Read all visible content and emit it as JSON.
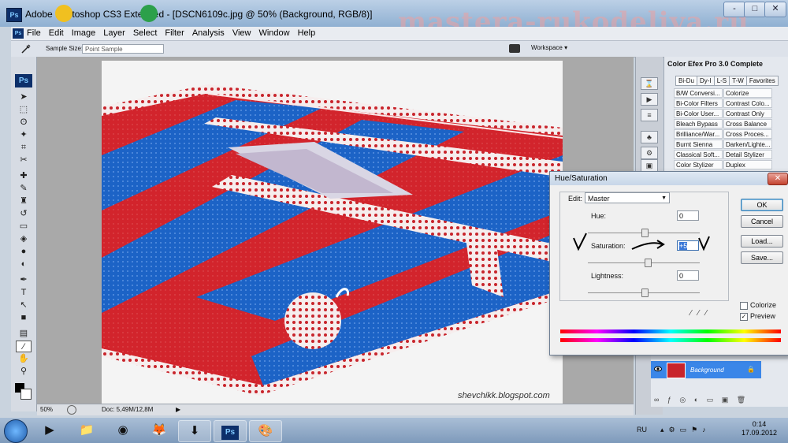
{
  "window": {
    "title": "Adobe Photoshop CS3 Extended - [DSCN6109c.jpg @ 50% (Background, RGB/8)]",
    "logo": "Ps",
    "minimize": "-",
    "restore": "□",
    "close": "✕"
  },
  "watermark": "mastera-rukodeliya.ru",
  "menu": [
    "File",
    "Edit",
    "Image",
    "Layer",
    "Select",
    "Filter",
    "Analysis",
    "View",
    "Window",
    "Help"
  ],
  "options": {
    "sample_size_label": "Sample Size:",
    "sample_size_value": "Point Sample",
    "workspace": "Workspace ▾"
  },
  "toolbox": {
    "logo": "Ps"
  },
  "photo": {
    "credit": "shevchikk.blogspot.com"
  },
  "status": {
    "zoom": "50%",
    "doc": "Doc: 5,49M/12,8M"
  },
  "efex": {
    "title": "Color Efex Pro 3.0 Complete",
    "tabs": [
      "Bi-Du",
      "Dy-I",
      "L-S",
      "T-W",
      "Favorites"
    ],
    "filters": [
      [
        "B/W Conversi...",
        "Colorize"
      ],
      [
        "Bi-Color Filters",
        "Contrast Colo..."
      ],
      [
        "Bi-Color User...",
        "Contrast Only"
      ],
      [
        "Bleach Bypass",
        "Cross Balance"
      ],
      [
        "Brilliance/War...",
        "Cross Proces..."
      ],
      [
        "Burnt Sienna",
        "Darken/Lighte..."
      ],
      [
        "Classical Soft...",
        "Detail Stylizer"
      ],
      [
        "Color Stylizer",
        "Duplex"
      ]
    ]
  },
  "layers": {
    "background_layer": "Background"
  },
  "dialog": {
    "title": "Hue/Saturation",
    "edit_label": "Edit:",
    "edit_value": "Master",
    "hue_label": "Hue:",
    "hue_value": "0",
    "saturation_label": "Saturation:",
    "saturation_value": "+5",
    "lightness_label": "Lightness:",
    "lightness_value": "0",
    "ok": "OK",
    "cancel": "Cancel",
    "load": "Load...",
    "save": "Save...",
    "colorize": "Colorize",
    "preview": "Preview",
    "preview_checked": true
  },
  "taskbar": {
    "language": "RU",
    "time": "0:14",
    "date": "17.09.2012",
    "apps": [
      "windows-start",
      "media-player",
      "file-explorer",
      "chrome",
      "firefox",
      "installer",
      "photoshop",
      "paint"
    ]
  }
}
